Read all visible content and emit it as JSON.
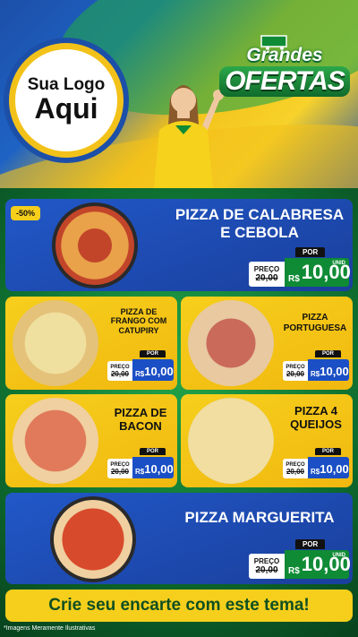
{
  "logo": {
    "line1": "Sua Logo",
    "line2": "Aqui"
  },
  "header": {
    "title_top": "Grandes",
    "title_bottom": "OFERTAS"
  },
  "products": [
    {
      "name": "PIZZA DE CALABRESA E CEBOLA",
      "badge": "-50%",
      "price_label": "PREÇO",
      "old_price": "20,00",
      "por": "POR",
      "currency": "R$",
      "new_price": "10,00",
      "unit": "UNID"
    },
    {
      "name": "PIZZA DE FRANGO COM CATUPIRY",
      "price_label": "PREÇO",
      "old_price": "20,00",
      "por": "POR",
      "currency": "R$",
      "new_price": "10,00"
    },
    {
      "name": "PIZZA PORTUGUESA",
      "price_label": "PREÇO",
      "old_price": "20,00",
      "por": "POR",
      "currency": "R$",
      "new_price": "10,00"
    },
    {
      "name": "PIZZA DE BACON",
      "price_label": "PREÇO",
      "old_price": "20,00",
      "por": "POR",
      "currency": "R$",
      "new_price": "10,00"
    },
    {
      "name": "PIZZA 4 QUEIJOS",
      "price_label": "PREÇO",
      "old_price": "20,00",
      "por": "POR",
      "currency": "R$",
      "new_price": "10,00"
    },
    {
      "name": "PIZZA MARGUERITA",
      "price_label": "PREÇO",
      "old_price": "20,00",
      "por": "POR",
      "currency": "R$",
      "new_price": "10,00",
      "unit": "UNID"
    }
  ],
  "cta": "Crie seu encarte com este tema!",
  "disclaimer": "*Imagens Meramente Ilustrativas",
  "colors": {
    "blue": "#1c4fa8",
    "yellow": "#f6cf1c",
    "green": "#0f8b35"
  }
}
